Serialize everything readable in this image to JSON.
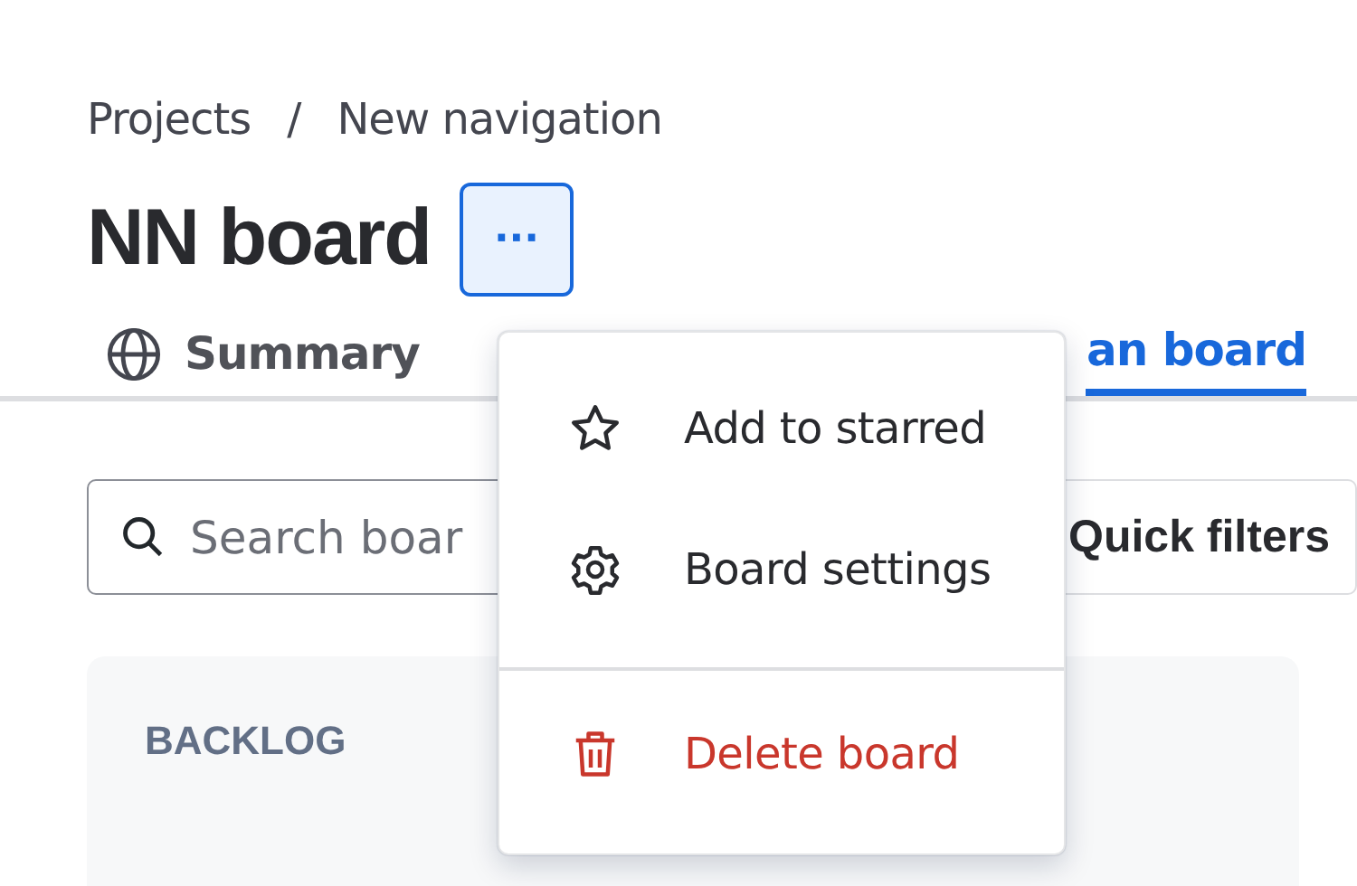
{
  "breadcrumb": [
    "Projects",
    "New navigation"
  ],
  "breadcrumb_separator": "/",
  "title": "NN board",
  "more_button": {
    "label": "···",
    "selected": true
  },
  "tabs": [
    {
      "label": "Summary",
      "selected": false
    },
    {
      "label": "an board",
      "selected": true
    }
  ],
  "search": {
    "placeholder": "Search boar"
  },
  "quick_filters": {
    "label": "Quick filters"
  },
  "columns": [
    {
      "title": "BACKLOG"
    }
  ],
  "menu": {
    "items": [
      {
        "label": "Add to starred",
        "kind": "star",
        "danger": false
      },
      {
        "label": "Board settings",
        "kind": "gear",
        "danger": false
      },
      {
        "label": "Delete board",
        "kind": "trash",
        "danger": true
      }
    ]
  }
}
